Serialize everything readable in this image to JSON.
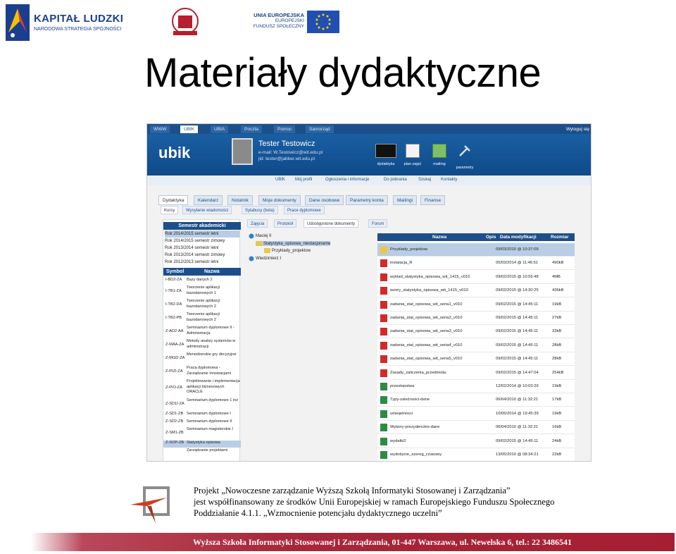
{
  "logos": {
    "kapital_title": "KAPITAŁ LUDZKI",
    "kapital_sub": "NARODOWA STRATEGIA SPÓJNOŚCI",
    "ue_line1": "UNIA EUROPEJSKA",
    "ue_line2": "EUROPEJSKI",
    "ue_line3": "FUNDUSZ SPOŁECZNY"
  },
  "page_title": "Materiały dydaktyczne",
  "app": {
    "topnav": [
      "WWW",
      "UBIK",
      "UBIA",
      "Poczta",
      "Pomoc",
      "Samorząd"
    ],
    "logout": "Wyloguj się",
    "logo_text": "ubik",
    "user": {
      "name": "Tester Testowicz",
      "email": "e-mail: W.Testowicz@wit.edu.pl",
      "jid": "jid: tester@jabber.wit.edu.pl"
    },
    "banner_icons": [
      {
        "label": "dydaktyka",
        "icon": "blackboard-icon"
      },
      {
        "label": "plan zajęć",
        "icon": "schedule-icon"
      },
      {
        "label": "mailing",
        "icon": "mailing-icon"
      },
      {
        "label": "parametry",
        "icon": "tools-icon"
      }
    ],
    "subnav": [
      "UBIK",
      "Mój profil",
      "Ogłoszenia i informacje",
      "Do pobrania",
      "Szukaj",
      "Kontakty"
    ],
    "main_tabs": [
      "Dydaktyka",
      "Kalendarz",
      "Notatnik",
      "Moje dokumenty",
      "Dane osobowe",
      "Parametry konta",
      "Mailingi",
      "Finanse"
    ],
    "sub_tabs": [
      "Kursy",
      "Wysyłanie wiadomości",
      "Sylabusy (beta)",
      "Prace dyplomowe"
    ],
    "semester_header": "Semestr akademicki",
    "semesters": [
      "Rok 2014/2015 semestr letni",
      "Rok 2014/2015 semestr zimowy",
      "Rok 2013/2014 semestr letni",
      "Rok 2013/2014 semestr zimowy",
      "Rok 2012/2013 semestr letni"
    ],
    "course_header_symbol": "Symbol",
    "course_header_name": "Nazwa",
    "courses": [
      {
        "code": "I-BD2-ZA",
        "name": "Bazy danych 2"
      },
      {
        "code": "I-TB1-ZA",
        "name": "Tworzenie aplikacji bazodanowych 1"
      },
      {
        "code": "I-TB2-DA",
        "name": "Tworzenie aplikacji bazodanowych 2"
      },
      {
        "code": "I-TB2-PB",
        "name": "Tworzenie aplikacji bazodanowych 2"
      },
      {
        "code": "Z-AD2-AA",
        "name": "Seminarium dyplomowe II - Administracja"
      },
      {
        "code": "Z-MAA-ZA",
        "name": "Metody analizy systemów w administracji"
      },
      {
        "code": "Z-MGD-ZA",
        "name": "Menedżerskie gry decyzyjne"
      },
      {
        "code": "Z-PIZI-ZA",
        "name": "Praca dyplomowa - Zarządzanie innowacjami"
      },
      {
        "code": "Z-PIO-ZA",
        "name": "Projektowanie i implementacja aplikacji biznesowych ORACLE"
      },
      {
        "code": "Z-SD1I-ZA",
        "name": "Seminarium dyplomowe 1 inż"
      },
      {
        "code": "Z-SD1-ZB",
        "name": "Seminarium dyplomowe I"
      },
      {
        "code": "Z-SD2-ZB",
        "name": "Seminarium dyplomowe II"
      },
      {
        "code": "Z-SM1-ZB",
        "name": "Seminarium magisterskie I"
      },
      {
        "code": "Z-SOP-ZB",
        "name": "Statystyka opisowa"
      },
      {
        "code": "",
        "name": "Zarządzanie projektami"
      }
    ],
    "doc_tabs": [
      "Zajęcia",
      "Protokół",
      "Udostępnione dokumenty",
      "Forum"
    ],
    "tree": {
      "root1": "Maciej II",
      "folder1": "Statystyka_opisowa_niestacjonarne",
      "folder2": "Przyklady_projektow",
      "root2": "Wiedzimierz I"
    },
    "file_header": {
      "name": "Nazwa",
      "desc": "Opis",
      "date": "Data modyfikacji",
      "size": "Rozmiar"
    },
    "files": [
      {
        "name": "Przyklady_projektow",
        "date": "09/03/2010 @ 10:37:09",
        "size": "",
        "type": "folder"
      },
      {
        "name": "instalacja_R",
        "date": "05/03/2014 @ 11:46:51",
        "size": "490kB",
        "type": "pdf"
      },
      {
        "name": "wyklad_statystyka_opisowa_wit_1415_v010",
        "date": "09/02/2015 @ 10:55:48",
        "size": "4MB",
        "type": "pdf"
      },
      {
        "name": "wzory_statystyka_opisowa_wit_1415_v010",
        "date": "09/02/2015 @ 14:30:25",
        "size": "436kB",
        "type": "pdf"
      },
      {
        "name": "zadania_stat_opisowa_wit_seria1_v010",
        "date": "09/02/2015 @ 14:45:11",
        "size": "19kB",
        "type": "pdf"
      },
      {
        "name": "zadania_stat_opisowa_wit_seria2_v010",
        "date": "09/02/2015 @ 14:45:11",
        "size": "27kB",
        "type": "pdf"
      },
      {
        "name": "zadania_stat_opisowa_wit_seria3_v010",
        "date": "09/02/2015 @ 14:45:11",
        "size": "33kB",
        "type": "pdf"
      },
      {
        "name": "zadania_stat_opisowa_wit_seria4_v010",
        "date": "09/02/2015 @ 14:45:11",
        "size": "28kB",
        "type": "pdf"
      },
      {
        "name": "zadania_stat_opisowa_wit_seria5_v010",
        "date": "09/02/2015 @ 14:45:11",
        "size": "28kB",
        "type": "pdf"
      },
      {
        "name": "Zasady_zaliczenia_przedmiotu",
        "date": "09/02/2015 @ 14:47:04",
        "size": "254kB",
        "type": "pdf"
      },
      {
        "name": "przestepstwa",
        "date": "12/02/2014 @ 10:03:29",
        "size": "19kB",
        "type": "xls"
      },
      {
        "name": "Typy-zależności-dane",
        "date": "06/04/2010 @ 11:32:21",
        "size": "17kB",
        "type": "xls"
      },
      {
        "name": "umiejetnosci",
        "date": "10/05/2014 @ 19:45:39",
        "size": "19kB",
        "type": "xls"
      },
      {
        "name": "Wybory-prezydenckie-dane",
        "date": "06/04/2010 @ 11:32:21",
        "size": "16kB",
        "type": "xls"
      },
      {
        "name": "wydatki2",
        "date": "09/02/2015 @ 14:45:11",
        "size": "24kB",
        "type": "xls"
      },
      {
        "name": "wydobycie_szereg_czasowy",
        "date": "13/05/2010 @ 08:34:21",
        "size": "22kB",
        "type": "xls"
      }
    ]
  },
  "footer": {
    "line1": "Projekt „Nowoczesne zarządzanie Wyższą Szkołą Informatyki Stosowanej i Zarządzania”",
    "line2": "jest współfinansowany ze środków Unii Europejskiej w ramach Europejskiego Funduszu Społecznego",
    "line3": "Poddziałanie 4.1.1. „Wzmocnienie potencjału dydaktycznego uczelni”",
    "address": "Wyższa Szkoła Informatyki Stosowanej i Zarządzania, 01-447 Warszawa, ul. Newelska 6, tel.: 22 3486541"
  },
  "colors": {
    "accent": "#1c4f8a",
    "selection": "#b9cde6",
    "footer_bar": "#a51f33"
  }
}
